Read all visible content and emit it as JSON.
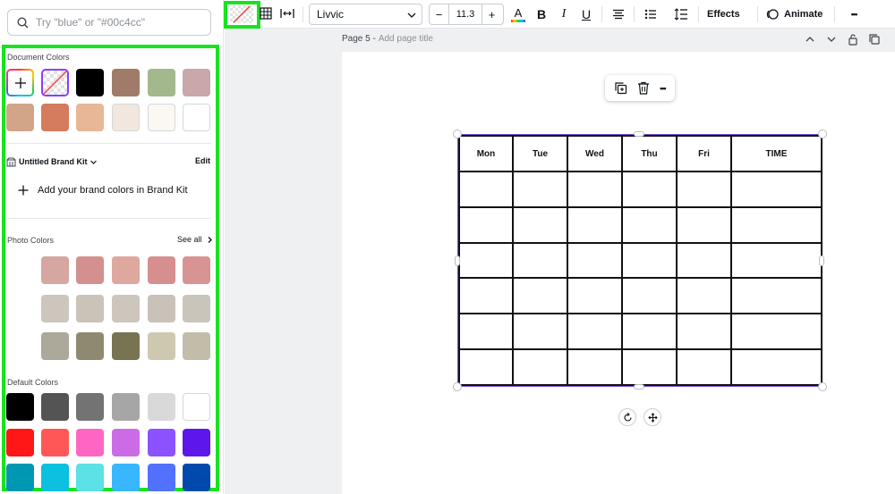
{
  "search": {
    "placeholder": "Try \"blue\" or \"#00c4cc\""
  },
  "document_colors": {
    "title": "Document Colors",
    "row1": [
      "#000000",
      "#a17b69",
      "#a4b88d",
      "#c9a7ab"
    ],
    "row2": [
      "#d2a488",
      "#d47c5d",
      "#e7b797",
      "#f1e7dc",
      "#fbf8f1",
      "#ffffff"
    ]
  },
  "brand_kit": {
    "name": "Untitled Brand Kit",
    "edit_label": "Edit",
    "add_label": "Add your brand colors in Brand Kit"
  },
  "photo_colors": {
    "title": "Photo Colors",
    "see_all": "See all",
    "rows": [
      [
        "#d6a6a1",
        "#d3908e",
        "#dea89e",
        "#d68f8e",
        "#d89492"
      ],
      [
        "#cdc6bc",
        "#cbc3b8",
        "#cdc6bc",
        "#cac2b8",
        "#cac5ba"
      ],
      [
        "#aca89a",
        "#8e8a71",
        "#787451",
        "#cec8b1",
        "#c2bda8"
      ]
    ]
  },
  "default_colors": {
    "title": "Default Colors",
    "rows": [
      [
        "#000000",
        "#545454",
        "#737373",
        "#a6a6a6",
        "#d9d9d9",
        "#ffffff"
      ],
      [
        "#ff1616",
        "#ff5757",
        "#ff66c4",
        "#cb6ce6",
        "#8c52ff",
        "#5e17eb"
      ],
      [
        "#0097b2",
        "#0cc0df",
        "#5ce1e6",
        "#38b6ff",
        "#5271ff",
        "#004aad"
      ]
    ]
  },
  "toolbar": {
    "font_name": "Livvic",
    "font_size": "11.3",
    "minus": "−",
    "plus": "+",
    "text_color_letter": "A",
    "bold": "B",
    "italic": "I",
    "underline": "U",
    "effects_label": "Effects",
    "animate_label": "Animate",
    "more": "•••"
  },
  "page": {
    "label": "Page 5 -",
    "title_placeholder": "Add page title"
  },
  "table": {
    "headers": [
      "Mon",
      "Tue",
      "Wed",
      "Thu",
      "Fri",
      "TIME"
    ],
    "rows": 6
  },
  "colors": {
    "accent": "#8b3dff",
    "highlight": "#18e31f",
    "selection": "#7d4bd6"
  }
}
